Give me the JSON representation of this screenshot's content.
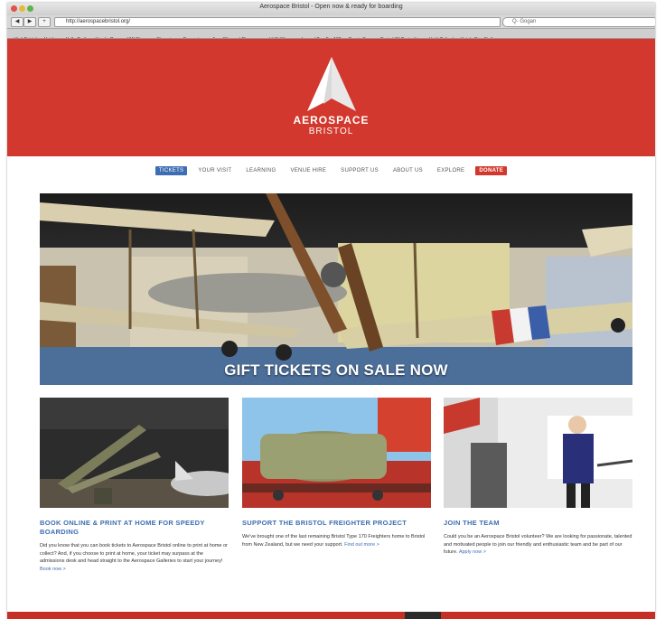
{
  "browser": {
    "window_title": "Aerospace Bristol - Open now & ready for boarding",
    "url": "http://aerospacebristol.org/",
    "search_placeholder": "Q- Gogan",
    "nav_buttons": [
      "◀",
      "▶",
      "+"
    ],
    "bookmarks": [
      "Visit Bristol",
      "Hotdog",
      "Hello Trails",
      "Honda Guar",
      "VW Shows",
      "Shopping",
      "Carpenters",
      "Aero Film and Dinosaurs",
      "Hi Fi Winner",
      "Learn / TrueFan100",
      "Comin Soon",
      "Period Of Curiosities",
      "Hold Oxford",
      "Hotels Bier Steiber"
    ]
  },
  "site": {
    "logo_line1": "AEROSPACE",
    "logo_line2": "BRISTOL",
    "nav": [
      {
        "label": "TICKETS",
        "style": "active"
      },
      {
        "label": "YOUR VISIT",
        "style": ""
      },
      {
        "label": "LEARNING",
        "style": ""
      },
      {
        "label": "VENUE HIRE",
        "style": ""
      },
      {
        "label": "SUPPORT US",
        "style": ""
      },
      {
        "label": "ABOUT US",
        "style": ""
      },
      {
        "label": "EXPLORE",
        "style": ""
      },
      {
        "label": "DONATE",
        "style": "donate"
      }
    ],
    "hero_caption": "GIFT TICKETS ON SALE NOW",
    "cards": [
      {
        "title": "BOOK ONLINE & PRINT AT HOME FOR SPEEDY BOARDING",
        "body": "Did you know that you can book tickets to Aerospace Bristol online to print at home or collect? And, if you choose to print at home, your ticket may surpass at the admissions desk and head straight to the Aerospace Galleries to start your journey!",
        "more": "Book now >"
      },
      {
        "title": "SUPPORT THE BRISTOL FREIGHTER PROJECT",
        "body": "We've brought one of the last remaining Bristol Type 170 Freighters home to Bristol from New Zealand, but we need your support.",
        "more": "Find out more >"
      },
      {
        "title": "JOIN THE TEAM",
        "body": "Could you be an Aerospace Bristol volunteer? We are looking for passionate, talented and motivated people to join our friendly and enthusiastic team and be part of our future.",
        "more": "Apply now >"
      }
    ]
  },
  "colors": {
    "brand_red": "#d2382d",
    "link_blue": "#3d6db3"
  }
}
